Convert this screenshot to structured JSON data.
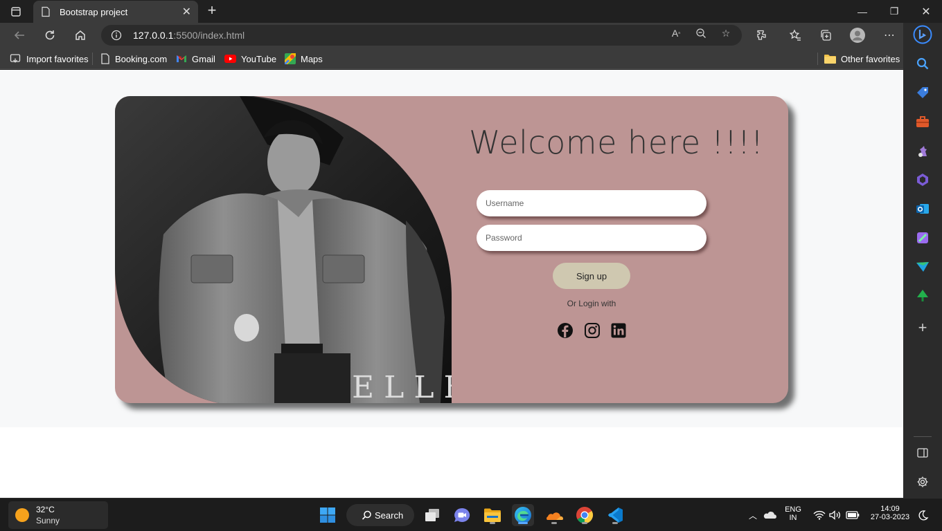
{
  "browser": {
    "tab_title": "Bootstrap project",
    "url_host": "127.0.0.1",
    "url_path": ":5500/index.html",
    "favorites": [
      "Import favorites",
      "Booking.com",
      "Gmail",
      "YouTube",
      "Maps"
    ],
    "other_favorites": "Other favorites"
  },
  "page": {
    "heading": "Welcome here !!!!",
    "username_placeholder": "Username",
    "password_placeholder": "Password",
    "signup_label": "Sign up",
    "or_login": "Or Login with",
    "magazine_logo": "ELLE",
    "colors": {
      "card": "#bd9594",
      "signup": "#cfc8b0"
    }
  },
  "taskbar": {
    "temp": "32°C",
    "condition": "Sunny",
    "search_label": "Search",
    "lang": "ENG",
    "region": "IN",
    "time": "14:09",
    "date": "27-03-2023"
  }
}
